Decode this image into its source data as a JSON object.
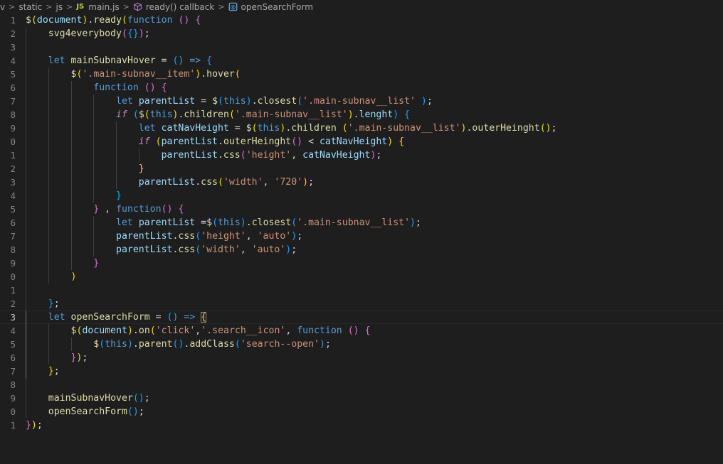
{
  "breadcrumb": {
    "items": [
      "v",
      "static",
      "js",
      "main.js",
      "ready() callback",
      "openSearchForm"
    ],
    "file_badge": "JS",
    "icons": [
      "chevron-right-icon",
      "js-file-icon",
      "cube-icon",
      "function-icon"
    ]
  },
  "editor": {
    "current_line": 23,
    "line_numbers": [
      "1",
      "2",
      "3",
      "4",
      "5",
      "6",
      "7",
      "8",
      "9",
      "0",
      "1",
      "2",
      "3",
      "4",
      "5",
      "6",
      "7",
      "8",
      "9",
      "0",
      "1",
      "2",
      "3",
      "4",
      "5",
      "6",
      "7",
      "8",
      "9",
      "0",
      "1"
    ],
    "lines": [
      [
        [
          "$",
          "fn"
        ],
        [
          "(",
          "b1"
        ],
        [
          "document",
          "var"
        ],
        [
          ")",
          "b1"
        ],
        [
          ".",
          "plain"
        ],
        [
          "ready",
          "fn"
        ],
        [
          "(",
          "b1"
        ],
        [
          "function",
          "kw"
        ],
        [
          " ",
          "plain"
        ],
        [
          "()",
          "b2"
        ],
        [
          " ",
          "plain"
        ],
        [
          "{",
          "b2"
        ]
      ],
      [
        [
          "    ",
          "plain"
        ],
        [
          "svg4everybody",
          "fn"
        ],
        [
          "(",
          "b2"
        ],
        [
          "{}",
          "b3"
        ],
        [
          ")",
          "b2"
        ],
        [
          ";",
          "plain"
        ]
      ],
      [],
      [
        [
          "    ",
          "plain"
        ],
        [
          "let",
          "kw"
        ],
        [
          " ",
          "plain"
        ],
        [
          "mainSubnavHover",
          "fn"
        ],
        [
          " = ",
          "plain"
        ],
        [
          "()",
          "b3"
        ],
        [
          " ",
          "plain"
        ],
        [
          "=>",
          "kw"
        ],
        [
          " ",
          "plain"
        ],
        [
          "{",
          "b3"
        ]
      ],
      [
        [
          "        ",
          "plain"
        ],
        [
          "$",
          "fn"
        ],
        [
          "(",
          "b1"
        ],
        [
          "'.main-subnav__item'",
          "str"
        ],
        [
          ")",
          "b1"
        ],
        [
          ".",
          "plain"
        ],
        [
          "hover",
          "fn"
        ],
        [
          "(",
          "b1"
        ]
      ],
      [
        [
          "            ",
          "plain"
        ],
        [
          "function",
          "kw"
        ],
        [
          " ",
          "plain"
        ],
        [
          "()",
          "b2"
        ],
        [
          " ",
          "plain"
        ],
        [
          "{",
          "b2"
        ]
      ],
      [
        [
          "                ",
          "plain"
        ],
        [
          "let",
          "kw"
        ],
        [
          " ",
          "plain"
        ],
        [
          "parentList",
          "var"
        ],
        [
          " = ",
          "plain"
        ],
        [
          "$",
          "fn"
        ],
        [
          "(",
          "b3"
        ],
        [
          "this",
          "kw"
        ],
        [
          ")",
          "b3"
        ],
        [
          ".",
          "plain"
        ],
        [
          "closest",
          "fn"
        ],
        [
          "(",
          "b3"
        ],
        [
          "'.main-subnav__list'",
          "str"
        ],
        [
          " ",
          "plain"
        ],
        [
          ")",
          "b3"
        ],
        [
          ";",
          "plain"
        ]
      ],
      [
        [
          "                ",
          "plain"
        ],
        [
          "if",
          "ctrl"
        ],
        [
          " ",
          "plain"
        ],
        [
          "(",
          "b3"
        ],
        [
          "$",
          "fn"
        ],
        [
          "(",
          "b1"
        ],
        [
          "this",
          "kw"
        ],
        [
          ")",
          "b1"
        ],
        [
          ".",
          "plain"
        ],
        [
          "children",
          "fn"
        ],
        [
          "(",
          "b1"
        ],
        [
          "'.main-subnav__list'",
          "str"
        ],
        [
          ")",
          "b1"
        ],
        [
          ".",
          "plain"
        ],
        [
          "lenght",
          "var"
        ],
        [
          ")",
          "b3"
        ],
        [
          " ",
          "plain"
        ],
        [
          "{",
          "b3"
        ]
      ],
      [
        [
          "                    ",
          "plain"
        ],
        [
          "let",
          "kw"
        ],
        [
          " ",
          "plain"
        ],
        [
          "catNavHeight",
          "var"
        ],
        [
          " = ",
          "plain"
        ],
        [
          "$",
          "fn"
        ],
        [
          "(",
          "b1"
        ],
        [
          "this",
          "kw"
        ],
        [
          ")",
          "b1"
        ],
        [
          ".",
          "plain"
        ],
        [
          "children",
          "fn"
        ],
        [
          " ",
          "plain"
        ],
        [
          "(",
          "b1"
        ],
        [
          "'.main-subnav__list'",
          "str"
        ],
        [
          ")",
          "b1"
        ],
        [
          ".",
          "plain"
        ],
        [
          "outerHeinght",
          "fn"
        ],
        [
          "()",
          "b1"
        ],
        [
          ";",
          "plain"
        ]
      ],
      [
        [
          "                    ",
          "plain"
        ],
        [
          "if",
          "ctrl"
        ],
        [
          " ",
          "plain"
        ],
        [
          "(",
          "b1"
        ],
        [
          "parentList",
          "var"
        ],
        [
          ".",
          "plain"
        ],
        [
          "outerHeinght",
          "fn"
        ],
        [
          "()",
          "b2"
        ],
        [
          " < ",
          "plain"
        ],
        [
          "catNavHeight",
          "var"
        ],
        [
          ")",
          "b1"
        ],
        [
          " ",
          "plain"
        ],
        [
          "{",
          "b1"
        ]
      ],
      [
        [
          "                        ",
          "plain"
        ],
        [
          "parentList",
          "var"
        ],
        [
          ".",
          "plain"
        ],
        [
          "css",
          "fn"
        ],
        [
          "(",
          "b2"
        ],
        [
          "'height'",
          "str"
        ],
        [
          ", ",
          "plain"
        ],
        [
          "catNavHeight",
          "var"
        ],
        [
          ")",
          "b2"
        ],
        [
          ";",
          "plain"
        ]
      ],
      [
        [
          "                    ",
          "plain"
        ],
        [
          "}",
          "b1"
        ]
      ],
      [
        [
          "                    ",
          "plain"
        ],
        [
          "parentList",
          "var"
        ],
        [
          ".",
          "plain"
        ],
        [
          "css",
          "fn"
        ],
        [
          "(",
          "b1"
        ],
        [
          "'width'",
          "str"
        ],
        [
          ", ",
          "plain"
        ],
        [
          "'720'",
          "str"
        ],
        [
          ")",
          "b1"
        ],
        [
          ";",
          "plain"
        ]
      ],
      [
        [
          "                ",
          "plain"
        ],
        [
          "}",
          "b3"
        ]
      ],
      [
        [
          "            ",
          "plain"
        ],
        [
          "}",
          "b2"
        ],
        [
          " , ",
          "plain"
        ],
        [
          "function",
          "kw"
        ],
        [
          "()",
          "b2"
        ],
        [
          " ",
          "plain"
        ],
        [
          "{",
          "b2"
        ]
      ],
      [
        [
          "                ",
          "plain"
        ],
        [
          "let",
          "kw"
        ],
        [
          " ",
          "plain"
        ],
        [
          "parentList",
          "var"
        ],
        [
          " =",
          "plain"
        ],
        [
          "$",
          "fn"
        ],
        [
          "(",
          "b3"
        ],
        [
          "this",
          "kw"
        ],
        [
          ")",
          "b3"
        ],
        [
          ".",
          "plain"
        ],
        [
          "closest",
          "fn"
        ],
        [
          "(",
          "b3"
        ],
        [
          "'.main-subnav__list'",
          "str"
        ],
        [
          ")",
          "b3"
        ],
        [
          ";",
          "plain"
        ]
      ],
      [
        [
          "                ",
          "plain"
        ],
        [
          "parentList",
          "var"
        ],
        [
          ".",
          "plain"
        ],
        [
          "css",
          "fn"
        ],
        [
          "(",
          "b3"
        ],
        [
          "'height'",
          "str"
        ],
        [
          ", ",
          "plain"
        ],
        [
          "'auto'",
          "str"
        ],
        [
          ")",
          "b3"
        ],
        [
          ";",
          "plain"
        ]
      ],
      [
        [
          "                ",
          "plain"
        ],
        [
          "parentList",
          "var"
        ],
        [
          ".",
          "plain"
        ],
        [
          "css",
          "fn"
        ],
        [
          "(",
          "b3"
        ],
        [
          "'width'",
          "str"
        ],
        [
          ", ",
          "plain"
        ],
        [
          "'auto'",
          "str"
        ],
        [
          ")",
          "b3"
        ],
        [
          ";",
          "plain"
        ]
      ],
      [
        [
          "            ",
          "plain"
        ],
        [
          "}",
          "b2"
        ]
      ],
      [
        [
          "        ",
          "plain"
        ],
        [
          ")",
          "b1"
        ]
      ],
      [],
      [
        [
          "    ",
          "plain"
        ],
        [
          "}",
          "b3"
        ],
        [
          ";",
          "plain"
        ]
      ],
      [
        [
          "    ",
          "plain"
        ],
        [
          "let",
          "kw"
        ],
        [
          " ",
          "plain"
        ],
        [
          "openSearchForm",
          "fn"
        ],
        [
          " = ",
          "plain"
        ],
        [
          "()",
          "b3"
        ],
        [
          " ",
          "plain"
        ],
        [
          "=>",
          "kw"
        ],
        [
          " ",
          "plain"
        ],
        [
          "{",
          "cursor"
        ]
      ],
      [
        [
          "        ",
          "plain"
        ],
        [
          "$",
          "fn"
        ],
        [
          "(",
          "b1"
        ],
        [
          "document",
          "var"
        ],
        [
          ")",
          "b1"
        ],
        [
          ".",
          "plain"
        ],
        [
          "on",
          "fn"
        ],
        [
          "(",
          "b1"
        ],
        [
          "'click'",
          "str"
        ],
        [
          ",",
          "plain"
        ],
        [
          "'.search__icon'",
          "str"
        ],
        [
          ", ",
          "plain"
        ],
        [
          "function",
          "kw"
        ],
        [
          " ",
          "plain"
        ],
        [
          "()",
          "b2"
        ],
        [
          " ",
          "plain"
        ],
        [
          "{",
          "b2"
        ]
      ],
      [
        [
          "            ",
          "plain"
        ],
        [
          "$",
          "fn"
        ],
        [
          "(",
          "b3"
        ],
        [
          "this",
          "kw"
        ],
        [
          ")",
          "b3"
        ],
        [
          ".",
          "plain"
        ],
        [
          "parent",
          "fn"
        ],
        [
          "()",
          "b3"
        ],
        [
          ".",
          "plain"
        ],
        [
          "addClass",
          "fn"
        ],
        [
          "(",
          "b3"
        ],
        [
          "'search--open'",
          "str"
        ],
        [
          ")",
          "b3"
        ],
        [
          ";",
          "plain"
        ]
      ],
      [
        [
          "        ",
          "plain"
        ],
        [
          "}",
          "b2"
        ],
        [
          ")",
          "b1"
        ],
        [
          ";",
          "plain"
        ]
      ],
      [
        [
          "    ",
          "plain"
        ],
        [
          "}",
          "b1"
        ],
        [
          ";",
          "plain"
        ]
      ],
      [],
      [
        [
          "    ",
          "plain"
        ],
        [
          "mainSubnavHover",
          "fn"
        ],
        [
          "()",
          "b3"
        ],
        [
          ";",
          "plain"
        ]
      ],
      [
        [
          "    ",
          "plain"
        ],
        [
          "openSearchForm",
          "fn"
        ],
        [
          "()",
          "b3"
        ],
        [
          ";",
          "plain"
        ]
      ],
      [
        [
          "}",
          "b2"
        ],
        [
          ")",
          "b1"
        ],
        [
          ";",
          "plain"
        ]
      ]
    ]
  },
  "theme": {
    "background": "#1e1e1e",
    "function": "#dcdcaa",
    "keyword": "#569cd6",
    "control": "#c586c0",
    "variable": "#9cdcfe",
    "string": "#ce9178",
    "bracket_1": "#ffd700",
    "bracket_2": "#da70d6",
    "bracket_3": "#179fff"
  }
}
